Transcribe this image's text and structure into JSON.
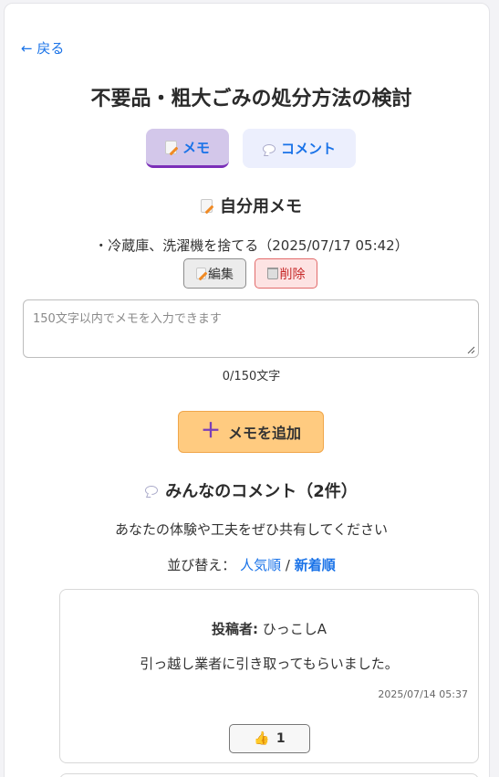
{
  "nav": {
    "back_label": "← 戻る"
  },
  "page": {
    "title": "不要品・粗大ごみの処分方法の検討"
  },
  "tabs": [
    {
      "label": "メモ",
      "icon": "memo-icon",
      "active": true
    },
    {
      "label": "コメント",
      "icon": "speech-bubble-icon",
      "active": false
    }
  ],
  "memo": {
    "heading": "自分用メモ",
    "items": [
      {
        "text": "・冷蔵庫、洗濯機を捨てる（2025/07/17 05:42）"
      }
    ],
    "edit_label": "編集",
    "delete_label": "削除",
    "input_placeholder": "150文字以内でメモを入力できます",
    "input_value": "",
    "char_count": "0/150文字",
    "add_label": "メモを追加",
    "add_icon": "＋"
  },
  "comments": {
    "heading": "みんなのコメント（2件）",
    "subtitle": "あなたの体験や工夫をぜひ共有してください",
    "sort_prefix": "並び替え：",
    "sort_popular": "人気順",
    "sort_separator": "/",
    "sort_newest": "新着順",
    "active_sort": "newest",
    "items": [
      {
        "author_label": "投稿者:",
        "author": "ひっこしA",
        "text": "引っ越し業者に引き取ってもらいました。",
        "time": "2025/07/14 05:37",
        "likes": "1",
        "like_icon": "👍"
      }
    ]
  },
  "colors": {
    "link": "#1a73e8",
    "tab_active_bg": "#d3c7ea",
    "tab_active_border": "#7b2fb8",
    "tab_inactive_bg": "#eceffd",
    "add_button_bg": "#ffcb80",
    "delete_button_bg": "#fde3e3"
  }
}
